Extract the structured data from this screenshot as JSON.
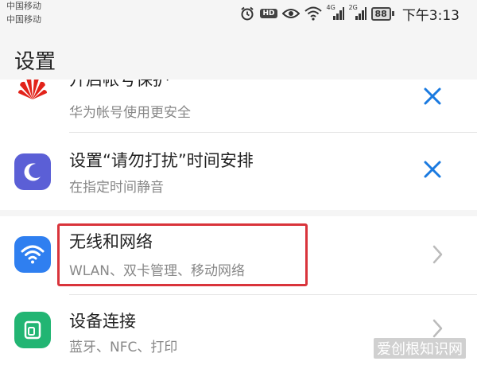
{
  "status_bar": {
    "carrier1": "中国移动",
    "carrier2": "中国移动",
    "hd": "HD",
    "net1": "4G",
    "net2": "2G",
    "battery": "88",
    "time": "下午3:13"
  },
  "header": {
    "title": "设置"
  },
  "rows": [
    {
      "title": "开启帐号保护",
      "subtitle": "华为帐号使用更安全",
      "icon": "huawei-logo-icon",
      "action": "close-icon"
    },
    {
      "title": "设置“请勿打扰”时间安排",
      "subtitle": "在指定时间静音",
      "icon": "moon-icon",
      "action": "close-icon"
    },
    {
      "title": "无线和网络",
      "subtitle": "WLAN、双卡管理、移动网络",
      "icon": "wifi-icon",
      "action": "chevron-right-icon"
    },
    {
      "title": "设备连接",
      "subtitle": "蓝牙、NFC、打印",
      "icon": "device-connection-icon",
      "action": "chevron-right-icon"
    }
  ],
  "colors": {
    "accent_blue": "#1a7ae0",
    "moon_icon_bg": "#5b5fd6",
    "wifi_icon_bg": "#2f7ff0",
    "device_icon_bg": "#22b573",
    "huawei_red": "#e2231a",
    "highlight_red": "#d9343b"
  },
  "watermark": "爱创根知识网"
}
